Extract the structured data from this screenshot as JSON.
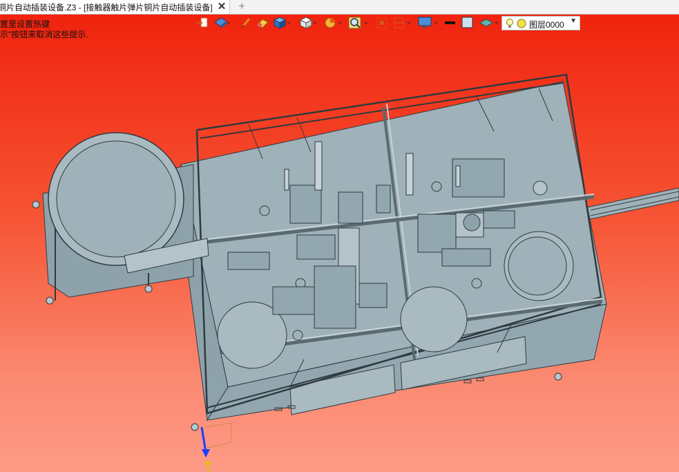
{
  "window": {
    "tab_title": "铜片自动插装设备.Z3 - [接触器触片弹片铜片自动插装设备]",
    "close_icon": "close-icon",
    "add_tab_icon": "plus-icon"
  },
  "hints": {
    "line1": "置里设置热键",
    "line2": "示\"按钮来取消这些提示."
  },
  "toolbar": {
    "icons": [
      "exit-sketch-icon",
      "view-orient-icon",
      "pen-icon",
      "eraser-icon",
      "cube-shaded-icon",
      "cube-white-icon",
      "pie-filter-icon",
      "zoom-icon",
      "fit-icon",
      "frame-icon",
      "monitor-icon",
      "line-color-icon",
      "fill-color-icon",
      "layer-style-icon"
    ],
    "layer": {
      "label": "图层0000",
      "bulb_icon": "lightbulb-icon",
      "dot_icon": "layer-color-dot-icon",
      "dropdown_icon": "chevron-down-icon"
    }
  },
  "colors": {
    "bg_top": "#f0230e",
    "bg_bottom": "#fd9a86",
    "machine": "#9fb1b9",
    "machine_line": "#2f3a3f"
  }
}
